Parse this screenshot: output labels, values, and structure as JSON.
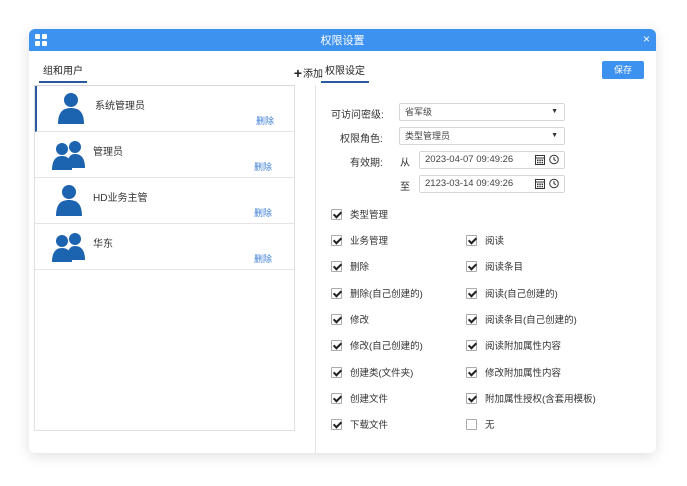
{
  "window": {
    "title": "权限设置",
    "close_label": "×"
  },
  "left": {
    "tab_label": "组和用户",
    "add_label": "添加",
    "users": [
      {
        "name": "系统管理员",
        "type": "user",
        "delete_label": "删除"
      },
      {
        "name": "管理员",
        "type": "group",
        "delete_label": "删除"
      },
      {
        "name": "HD业务主管",
        "type": "user",
        "delete_label": "删除"
      },
      {
        "name": "华东",
        "type": "group",
        "delete_label": "删除"
      }
    ]
  },
  "right": {
    "tab_label": "权限设定",
    "save_label": "保存",
    "access_level": {
      "label": "可访问密级:",
      "value": "省军级"
    },
    "role": {
      "label": "权限角色:",
      "value": "类型管理员"
    },
    "validity": {
      "label": "有效期:",
      "from_label": "从",
      "from_value": "2023-04-07 09:49:26",
      "to_label": "至",
      "to_value": "2123-03-14 09:49:26"
    },
    "permissions": {
      "top": {
        "label": "类型管理",
        "checked": true
      },
      "left_col": [
        {
          "label": "业务管理",
          "checked": true
        },
        {
          "label": "删除",
          "checked": true
        },
        {
          "label": "删除(自己创建的)",
          "checked": true
        },
        {
          "label": "修改",
          "checked": true
        },
        {
          "label": "修改(自己创建的)",
          "checked": true
        },
        {
          "label": "创建类(文件夹)",
          "checked": true
        },
        {
          "label": "创建文件",
          "checked": true
        },
        {
          "label": "下载文件",
          "checked": true
        }
      ],
      "right_col": [
        {
          "label": "阅读",
          "checked": true
        },
        {
          "label": "阅读条目",
          "checked": true
        },
        {
          "label": "阅读(自己创建的)",
          "checked": true
        },
        {
          "label": "阅读条目(自己创建的)",
          "checked": true
        },
        {
          "label": "阅读附加属性内容",
          "checked": true
        },
        {
          "label": "修改附加属性内容",
          "checked": true
        },
        {
          "label": "附加属性授权(含套用模板)",
          "checked": true
        },
        {
          "label": "无",
          "checked": false
        }
      ]
    }
  },
  "colors": {
    "accent": "#3d91ef",
    "avatar": "#1c64b0",
    "link": "#3d7fd8"
  }
}
